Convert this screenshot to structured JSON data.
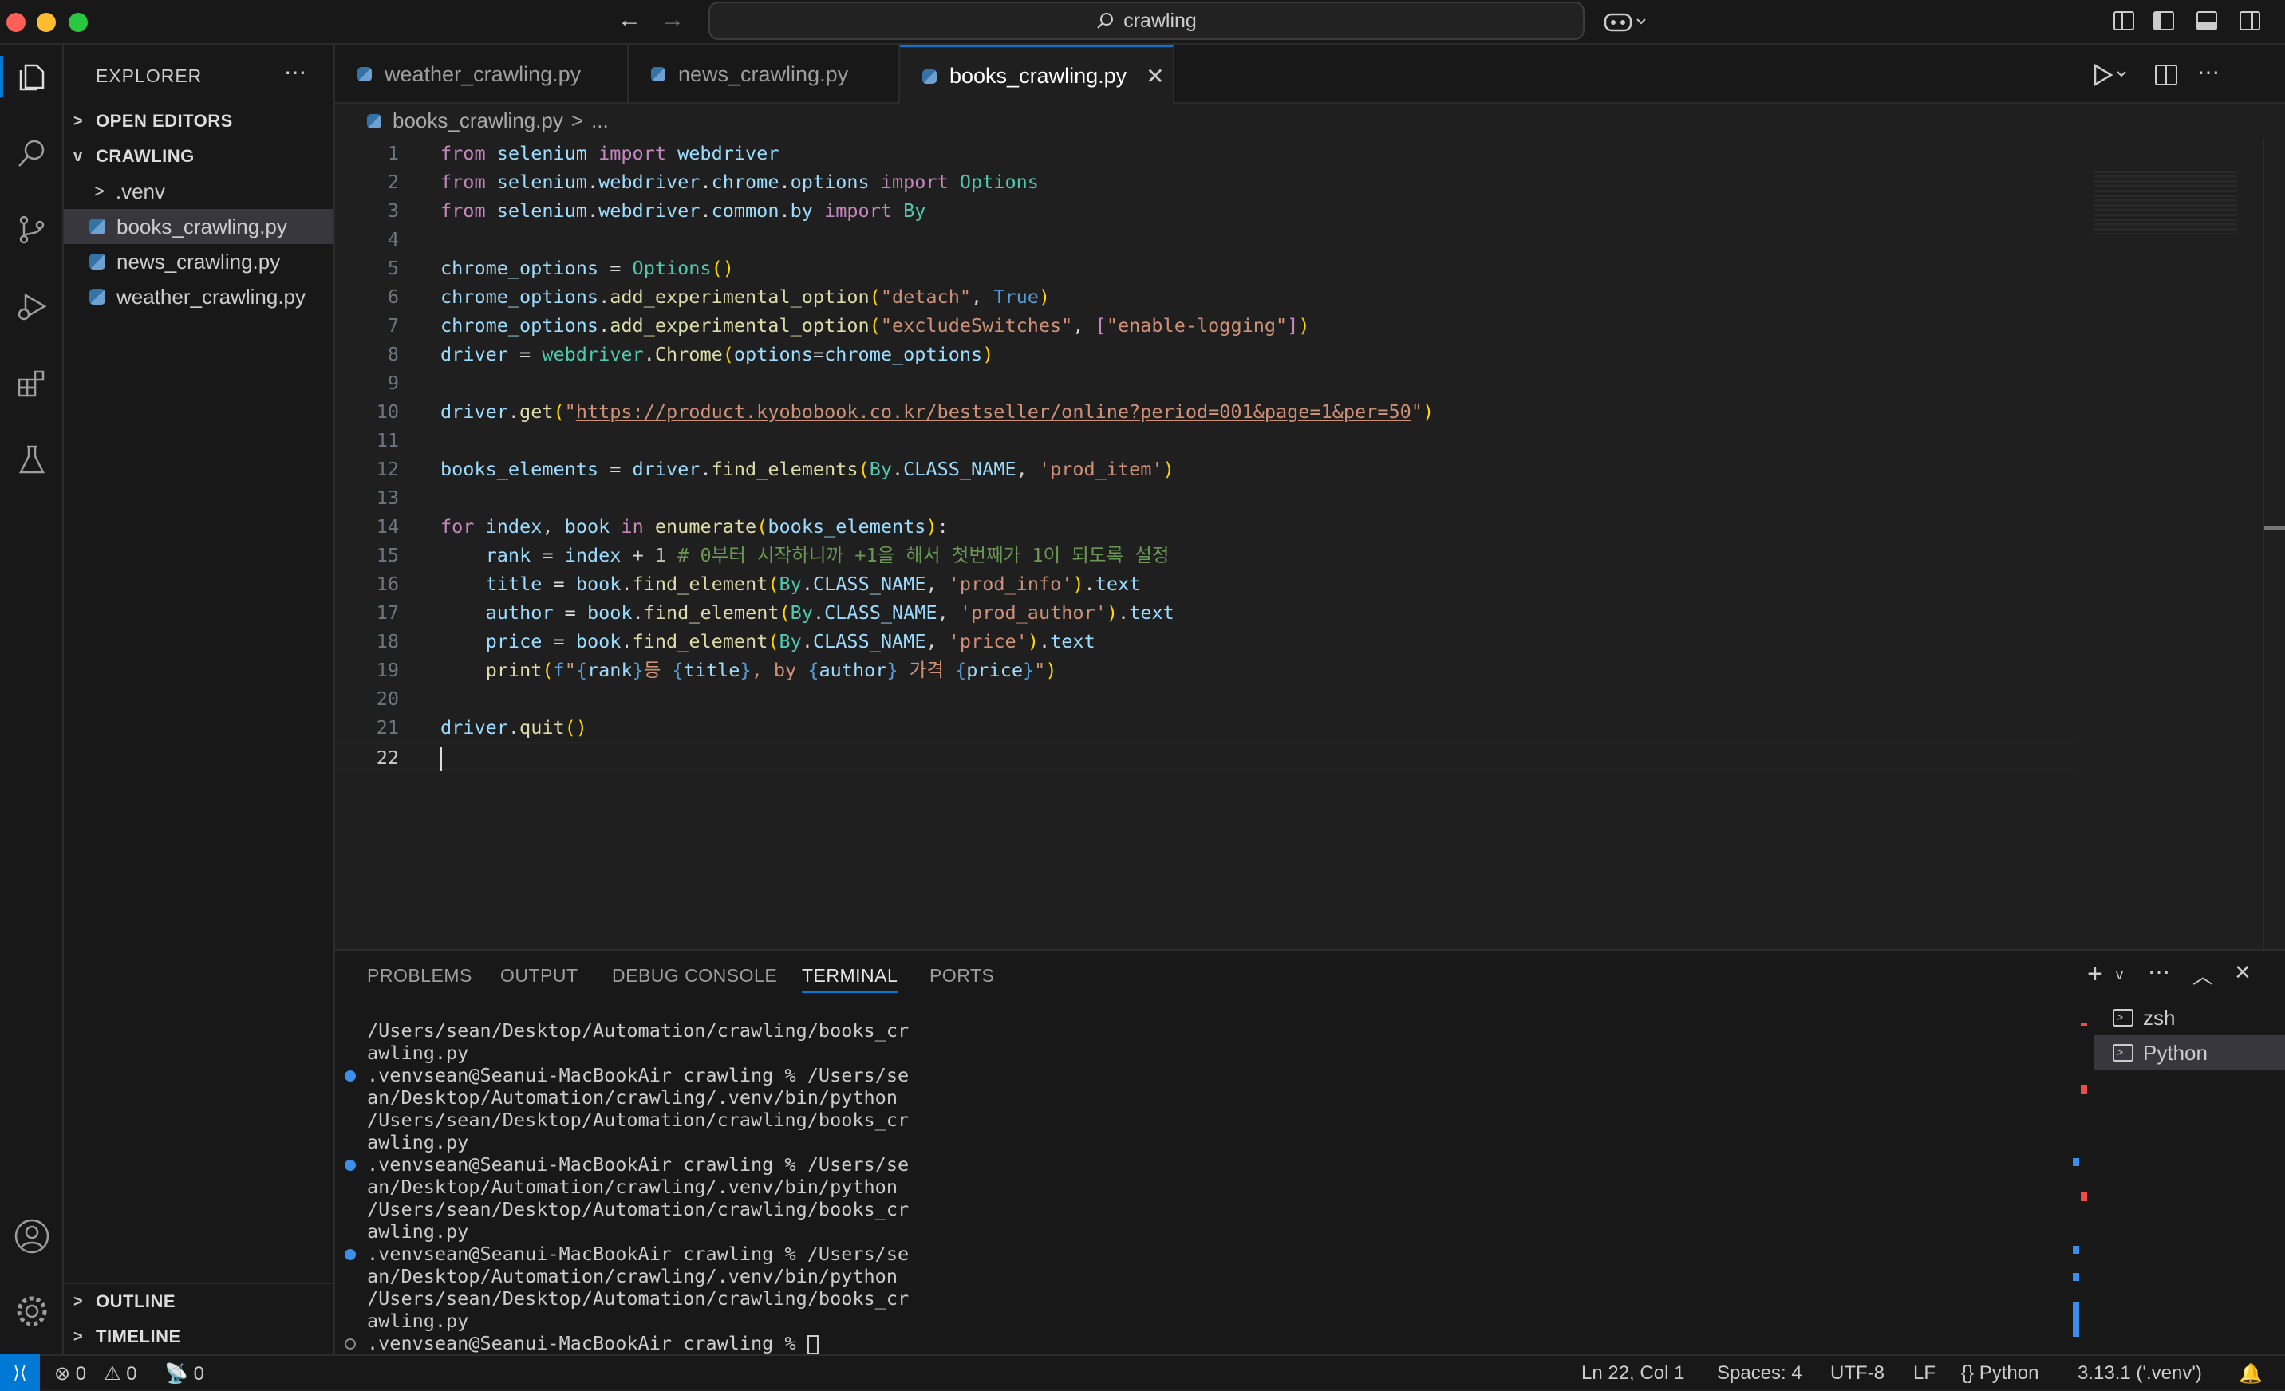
{
  "window": {
    "search_text": "crawling"
  },
  "explorer": {
    "title": "EXPLORER",
    "open_editors": "OPEN EDITORS",
    "folder": "CRAWLING",
    "items": [
      ".venv",
      "books_crawling.py",
      "news_crawling.py",
      "weather_crawling.py"
    ],
    "outline": "OUTLINE",
    "timeline": "TIMELINE"
  },
  "tabs": [
    "weather_crawling.py",
    "news_crawling.py",
    "books_crawling.py"
  ],
  "breadcrumb": {
    "file": "books_crawling.py",
    "more": "..."
  },
  "code_lines": [
    "from selenium import webdriver",
    "from selenium.webdriver.chrome.options import Options",
    "from selenium.webdriver.common.by import By",
    "",
    "chrome_options = Options()",
    "chrome_options.add_experimental_option(\"detach\", True)",
    "chrome_options.add_experimental_option(\"excludeSwitches\", [\"enable-logging\"])",
    "driver = webdriver.Chrome(options=chrome_options)",
    "",
    "driver.get(\"https://product.kyobobook.co.kr/bestseller/online?period=001&page=1&per=50\")",
    "",
    "books_elements = driver.find_elements(By.CLASS_NAME, 'prod_item')",
    "",
    "for index, book in enumerate(books_elements):",
    "    rank = index + 1 # 0부터 시작하니까 +1을 해서 첫번째가 1이 되도록 설정",
    "    title = book.find_element(By.CLASS_NAME, 'prod_info').text",
    "    author = book.find_element(By.CLASS_NAME, 'prod_author').text",
    "    price = book.find_element(By.CLASS_NAME, 'price').text",
    "    print(f\"{rank}등 {title}, by {author} 가격 {price}\")",
    "",
    "driver.quit()",
    ""
  ],
  "panel": {
    "tabs": [
      "PROBLEMS",
      "OUTPUT",
      "DEBUG CONSOLE",
      "TERMINAL",
      "PORTS"
    ],
    "terminal_lines": [
      "/Users/sean/Desktop/Automation/crawling/books_cr",
      "awling.py",
      ".venvsean@Seanui-MacBookAir crawling % /Users/se",
      "an/Desktop/Automation/crawling/.venv/bin/python",
      "/Users/sean/Desktop/Automation/crawling/books_cr",
      "awling.py",
      ".venvsean@Seanui-MacBookAir crawling % /Users/se",
      "an/Desktop/Automation/crawling/.venv/bin/python",
      "/Users/sean/Desktop/Automation/crawling/books_cr",
      "awling.py",
      ".venvsean@Seanui-MacBookAir crawling % /Users/se",
      "an/Desktop/Automation/crawling/.venv/bin/python",
      "/Users/sean/Desktop/Automation/crawling/books_cr",
      "awling.py",
      ".venvsean@Seanui-MacBookAir crawling % "
    ],
    "terminals": [
      "zsh",
      "Python"
    ]
  },
  "status": {
    "errors": "0",
    "warnings": "0",
    "ports": "0",
    "position": "Ln 22, Col 1",
    "spaces": "Spaces: 4",
    "encoding": "UTF-8",
    "eol": "LF",
    "language": "Python",
    "interpreter": "3.13.1 ('.venv')"
  },
  "colors": {
    "accent": "#0078d4",
    "background": "#1f1f1f",
    "sidebar": "#181818"
  }
}
